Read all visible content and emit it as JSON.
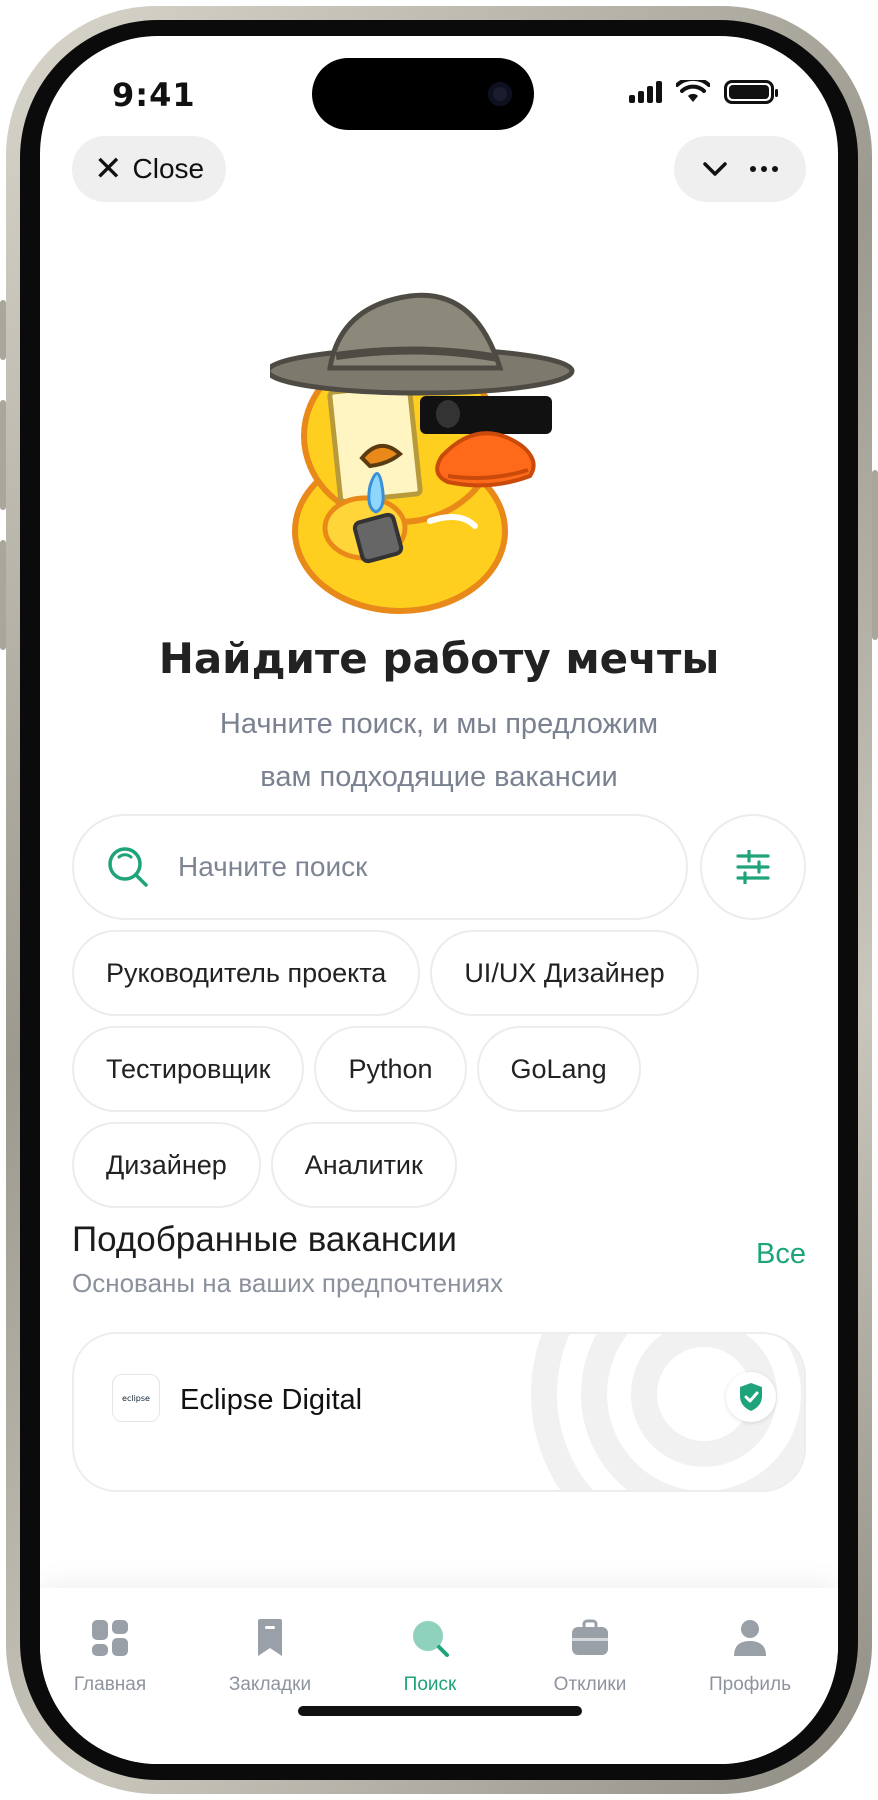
{
  "status_bar": {
    "time": "9:41"
  },
  "top_bar": {
    "close_label": "Close"
  },
  "hero": {
    "title": "Найдите работу мечты",
    "subtitle_line1": "Начните поиск, и мы предложим",
    "subtitle_line2": "вам подходящие вакансии"
  },
  "search": {
    "placeholder": "Начните поиск"
  },
  "suggestion_chips": [
    [
      "Руководитель проекта",
      "UI/UX Дизайнер"
    ],
    [
      "Тестировщик",
      "Python",
      "GoLang"
    ],
    [
      "Дизайнер",
      "Аналитик"
    ]
  ],
  "recommended": {
    "title": "Подобранные вакансии",
    "subtitle": "Основаны на ваших предпочтениях",
    "all_label": "Все",
    "card": {
      "company": "Eclipse Digital",
      "logo_text": "eclipse"
    }
  },
  "tab_bar": {
    "items": [
      {
        "label": "Главная",
        "icon": "home-icon"
      },
      {
        "label": "Закладки",
        "icon": "bookmark-icon"
      },
      {
        "label": "Поиск",
        "icon": "search-icon",
        "active": true
      },
      {
        "label": "Отклики",
        "icon": "briefcase-icon"
      },
      {
        "label": "Профиль",
        "icon": "profile-icon"
      }
    ]
  },
  "colors": {
    "accent": "#1ea37a",
    "muted_text": "#7a8190",
    "chip_border": "#ececec"
  }
}
